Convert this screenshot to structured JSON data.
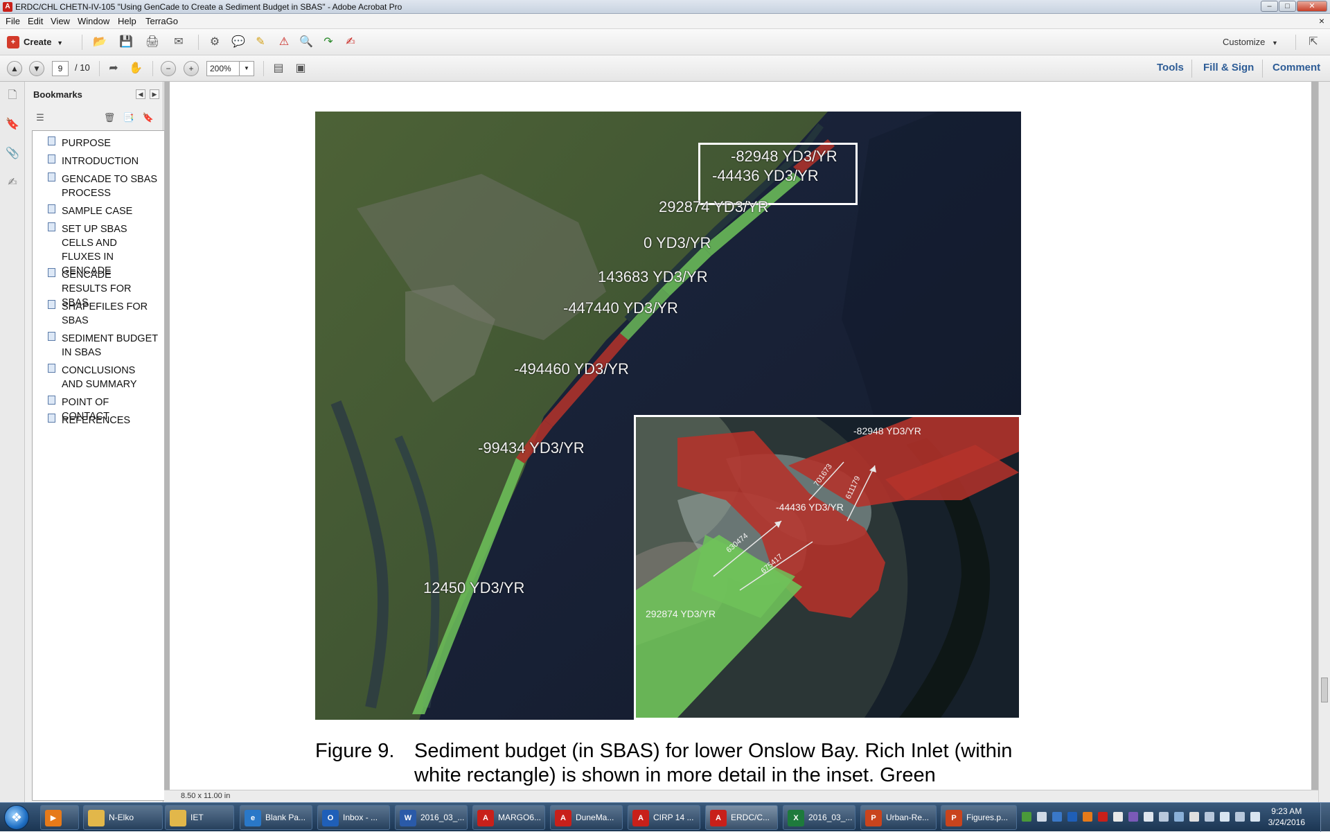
{
  "window": {
    "title": "ERDC/CHL CHETN-IV-105 \"Using GenCade to Create a Sediment Budget in SBAS\" - Adobe Acrobat Pro",
    "min": "–",
    "max": "□",
    "close": "✕"
  },
  "menu": {
    "items": [
      "File",
      "Edit",
      "View",
      "Window",
      "Help",
      "TerraGo"
    ],
    "close_doc": "×"
  },
  "toolbar": {
    "create_label": "Create",
    "customize_label": "Customize"
  },
  "navigation": {
    "page_current": "9",
    "page_total": "/ 10",
    "zoom": "200%"
  },
  "panels": {
    "tools": "Tools",
    "fill_sign": "Fill & Sign",
    "comment": "Comment"
  },
  "bookmarks": {
    "title": "Bookmarks",
    "items": [
      {
        "label": "PURPOSE"
      },
      {
        "label": "INTRODUCTION"
      },
      {
        "label": "GENCADE TO SBAS PROCESS"
      },
      {
        "label": "SAMPLE CASE"
      },
      {
        "label": "SET UP SBAS CELLS AND FLUXES IN GENCADE"
      },
      {
        "label": "GENCADE RESULTS FOR SBAS"
      },
      {
        "label": "SHAPEFILES FOR SBAS"
      },
      {
        "label": "SEDIMENT BUDGET IN SBAS"
      },
      {
        "label": "CONCLUSIONS AND SUMMARY"
      },
      {
        "label": "POINT OF CONTACT"
      },
      {
        "label": "REFERENCES"
      }
    ]
  },
  "figure": {
    "map_labels": {
      "l1": "-82948 YD3/YR",
      "l2": "-44436 YD3/YR",
      "l3": "292874 YD3/YR",
      "l4": "0 YD3/YR",
      "l5": "143683 YD3/YR",
      "l6": "-447440 YD3/YR",
      "l7": "-494460 YD3/YR",
      "l8": "-99434 YD3/YR",
      "l9": "12450 YD3/YR"
    },
    "inset_labels": {
      "top_right": "-82948 YD3/YR",
      "center": "-44436 YD3/YR",
      "bottom_left": "292874 YD3/YR"
    },
    "flux_labels": {
      "f1": "701673",
      "f2": "611179",
      "f3": "630474",
      "f4": "675417"
    },
    "caption_number": "Figure 9.",
    "caption_text": "Sediment budget (in SBAS) for lower Onslow Bay. Rich Inlet (within white rectangle) is shown in more detail in the inset. Green"
  },
  "status": {
    "page_size": "8.50 x 11.00 in"
  },
  "taskbar": {
    "items": [
      {
        "label": "N-Elko",
        "icon": "folder-icon",
        "color": "#e2b74a"
      },
      {
        "label": "IET",
        "icon": "folder-icon",
        "color": "#e2b74a"
      },
      {
        "label": "Blank Pa...",
        "icon": "ie-icon",
        "color": "#2a78c8"
      },
      {
        "label": "Inbox - ...",
        "icon": "outlook-icon",
        "color": "#1f5fb8"
      },
      {
        "label": "2016_03_...",
        "icon": "word-icon",
        "color": "#2a5aa8"
      },
      {
        "label": "MARGO6...",
        "icon": "pdf-icon",
        "color": "#c8201a"
      },
      {
        "label": "DuneMa...",
        "icon": "pdf-icon",
        "color": "#c8201a"
      },
      {
        "label": "CIRP 14 ...",
        "icon": "pdf-icon",
        "color": "#c8201a"
      },
      {
        "label": "ERDC/C...",
        "icon": "pdf-icon",
        "color": "#c8201a"
      },
      {
        "label": "2016_03_...",
        "icon": "excel-icon",
        "color": "#1e7a3c"
      },
      {
        "label": "Urban-Re...",
        "icon": "powerpoint-icon",
        "color": "#c9441d"
      },
      {
        "label": "Figures.p...",
        "icon": "powerpoint-icon",
        "color": "#c9441d"
      }
    ],
    "time": "9:23 AM",
    "date": "3/24/2016"
  },
  "colors": {
    "sand_green": "#6fc25a",
    "erosion_red": "#b5322a",
    "panel_blue": "#2d5c96"
  }
}
